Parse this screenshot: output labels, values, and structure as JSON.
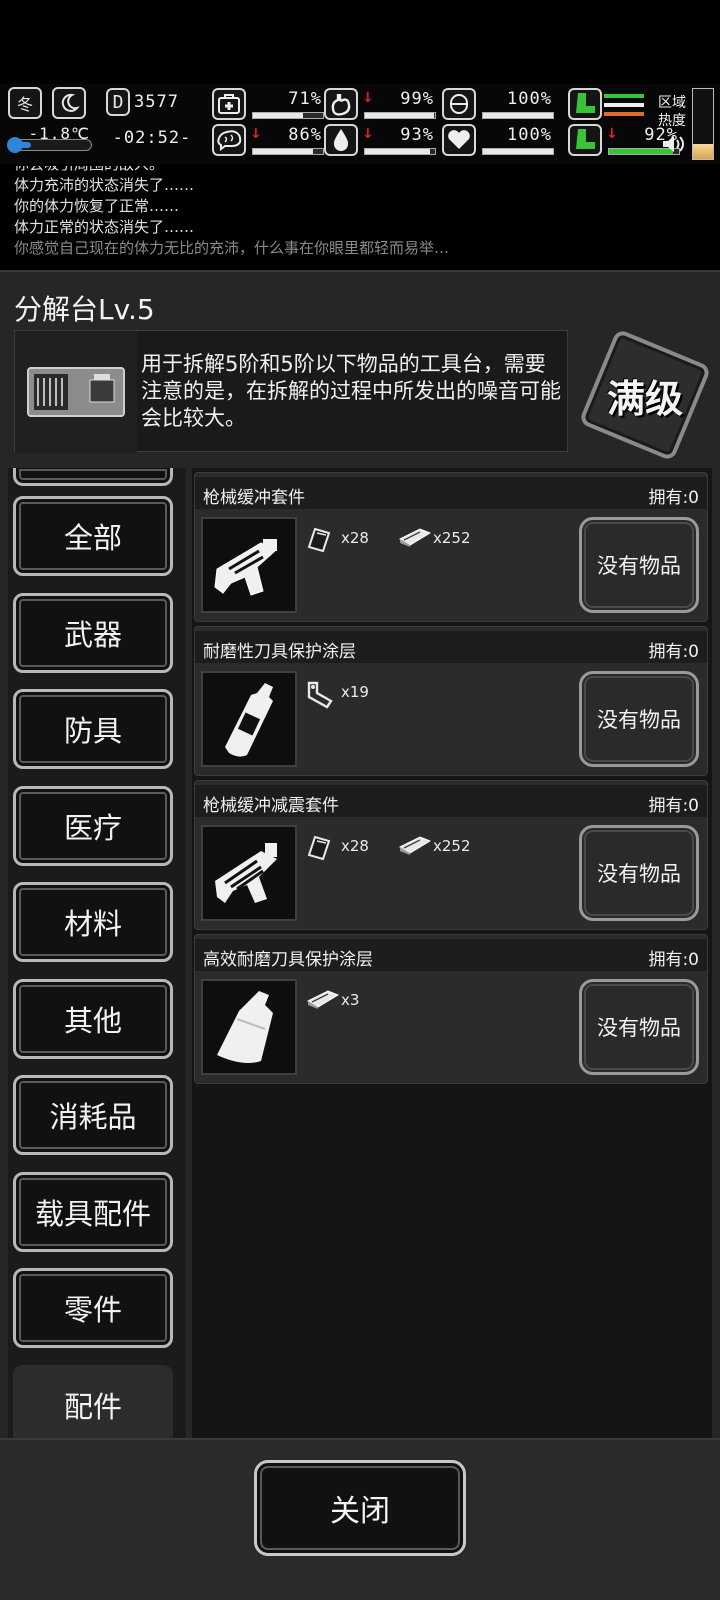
{
  "hud": {
    "season": "冬",
    "temperature": "-1.8℃",
    "temperature_fraction": 0.2,
    "day_count": "3577",
    "clock": "-02:52-",
    "stats": [
      {
        "id": "health",
        "icon": "medkit-icon",
        "value": "71%",
        "level": 0.71,
        "arrow": false
      },
      {
        "id": "hunger",
        "icon": "stomach-icon",
        "value": "99%",
        "level": 0.99,
        "arrow": true
      },
      {
        "id": "stamina",
        "icon": "lung-icon",
        "value": "100%",
        "level": 1.0,
        "arrow": false
      },
      {
        "id": "sanity",
        "icon": "brain-icon",
        "value": "86%",
        "level": 0.86,
        "arrow": true
      },
      {
        "id": "thirst",
        "icon": "water-drop-icon",
        "value": "93%",
        "level": 0.93,
        "arrow": true
      },
      {
        "id": "mood",
        "icon": "heart-icon",
        "value": "100%",
        "level": 1.0,
        "arrow": false
      },
      {
        "id": "leg",
        "icon": "boot-icon",
        "value": "92%",
        "level": 0.92,
        "arrow": true
      }
    ],
    "zone_heat_label_1": "区域",
    "zone_heat_label_2": "热度",
    "zone_heat_level": 0.22
  },
  "log": {
    "lines": [
      "你会吸引周围的敌人。",
      "体力充沛的状态消失了……",
      "你的体力恢复了正常……",
      "体力正常的状态消失了……",
      "你感觉自己现在的体力无比的充沛，什么事在你眼里都轻而易举…"
    ]
  },
  "panel": {
    "title": "分解台Lv.5",
    "description": "用于拆解5阶和5阶以下物品的工具台，需要注意的是，在拆解的过程中所发出的噪音可能会比较大。",
    "max_badge": "满级"
  },
  "categories": [
    "全部",
    "武器",
    "防具",
    "医疗",
    "材料",
    "其他",
    "消耗品",
    "载具配件",
    "零件",
    "配件"
  ],
  "active_category": "配件",
  "recipes": [
    {
      "name": "枪械缓冲套件",
      "owned": "拥有:0",
      "icon": "gun-buffer-kit-icon",
      "materials": [
        {
          "icon": "metal-plate-icon",
          "qty": "x28"
        },
        {
          "icon": "steel-bar-icon",
          "qty": "x252"
        }
      ],
      "action": "没有物品"
    },
    {
      "name": "耐磨性刀具保护涂层",
      "owned": "拥有:0",
      "icon": "coating-bottle-icon",
      "materials": [
        {
          "icon": "pipe-fitting-icon",
          "qty": "x19"
        }
      ],
      "action": "没有物品"
    },
    {
      "name": "枪械缓冲减震套件",
      "owned": "拥有:0",
      "icon": "gun-shock-kit-icon",
      "materials": [
        {
          "icon": "metal-plate-icon",
          "qty": "x28"
        },
        {
          "icon": "steel-bar-icon",
          "qty": "x252"
        }
      ],
      "action": "没有物品"
    },
    {
      "name": "高效耐磨刀具保护涂层",
      "owned": "拥有:0",
      "icon": "coating-can-icon",
      "materials": [
        {
          "icon": "steel-bar-icon",
          "qty": "x3"
        }
      ],
      "action": "没有物品"
    }
  ],
  "close_label": "关闭"
}
